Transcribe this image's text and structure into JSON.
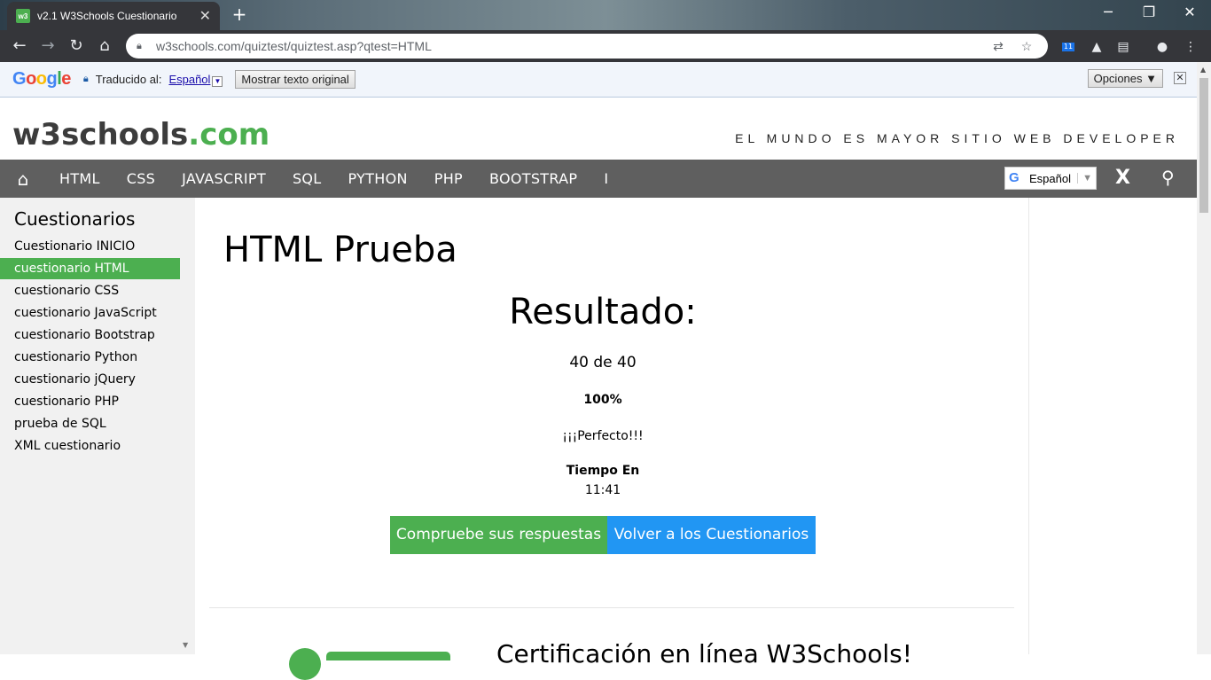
{
  "browser": {
    "tab_title": "v2.1 W3Schools Cuestionario",
    "tab_favicon": "w3",
    "tab_close": "✕",
    "new_tab": "+",
    "url": "w3schools.com/quiztest/quiztest.asp?qtest=HTML",
    "ext_badge": "11"
  },
  "translate_bar": {
    "logo": "Google",
    "translated_to_label": "Traducido al:",
    "language": "Español",
    "show_original": "Mostrar texto original",
    "options": "Opciones ▼"
  },
  "site": {
    "logo_main": "w3schools",
    "logo_com": ".com",
    "slogan": "EL MUNDO ES MAYOR SITIO WEB DEVELOPER",
    "nav": [
      "HTML",
      "CSS",
      "JAVASCRIPT",
      "SQL",
      "PYTHON",
      "PHP",
      "BOOTSTRAP",
      "I"
    ],
    "lang_select": "Español",
    "x_label": "X"
  },
  "sidebar": {
    "title": "Cuestionarios",
    "items": [
      "Cuestionario INICIO",
      "cuestionario HTML",
      "cuestionario CSS",
      "cuestionario JavaScript",
      "cuestionario Bootstrap",
      "cuestionario Python",
      "cuestionario jQuery",
      "cuestionario PHP",
      "prueba de SQL",
      "XML cuestionario"
    ],
    "active_index": 1
  },
  "main": {
    "title": "HTML Prueba",
    "result_title": "Resultado:",
    "score": "40 de 40",
    "percent": "100%",
    "message": "¡¡¡Perfecto!!!",
    "time_label": "Tiempo En",
    "time_value": "11:41",
    "check_button": "Compruebe sus respuestas",
    "back_button": "Volver a los Cuestionarios",
    "cert_title": "Certificación en línea W3Schools!"
  },
  "colors": {
    "accent_green": "#4caf50",
    "accent_blue": "#2196f3",
    "nav_gray": "#5f5f5f"
  }
}
